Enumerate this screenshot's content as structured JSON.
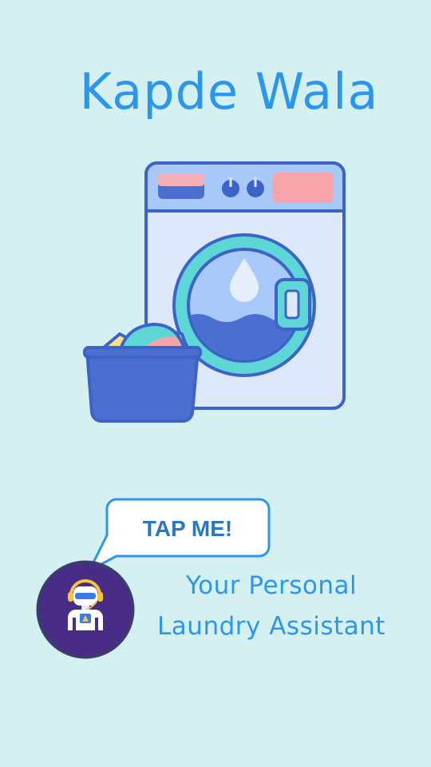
{
  "app": {
    "title": "Kapde Wala"
  },
  "hero": {
    "icon": "washing-machine-with-laundry-basket"
  },
  "assistant": {
    "button_label": "TAP ME!",
    "icon": "robot-assistant-icon"
  },
  "tagline": {
    "line1": "Your Personal",
    "line2": "Laundry Assistant"
  },
  "colors": {
    "background": "#d5f0f1",
    "accent": "#2a96f0",
    "bubble_text": "#2a78c2",
    "avatar_bg": "#482c86",
    "machine_outline": "#3b63c8"
  }
}
